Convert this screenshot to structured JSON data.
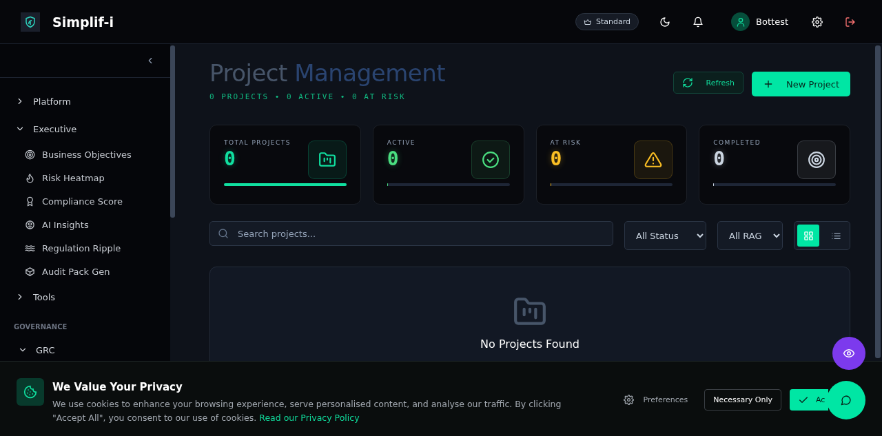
{
  "header": {
    "brand": "Simplif-i",
    "plan": "Standard",
    "user": "Bottest"
  },
  "sidebar": {
    "items": [
      {
        "label": "Platform",
        "expanded": false
      },
      {
        "label": "Executive",
        "expanded": true,
        "children": [
          {
            "label": "Business Objectives"
          },
          {
            "label": "Risk Heatmap"
          },
          {
            "label": "Compliance Score"
          },
          {
            "label": "AI Insights"
          },
          {
            "label": "Regulation Ripple"
          },
          {
            "label": "Audit Pack Gen"
          }
        ]
      },
      {
        "label": "Tools",
        "expanded": false
      }
    ],
    "section_label": "GOVERNANCE",
    "section_items": [
      {
        "label": "GRC",
        "expanded": true
      }
    ]
  },
  "page": {
    "title": "Project",
    "title_accent": "Management",
    "subtitle": "0 PROJECTS • 0 ACTIVE • 0 AT RISK",
    "buttons": [
      {
        "label": "Refresh",
        "kind": "secondary"
      },
      {
        "label": "New Project",
        "kind": "primary"
      }
    ]
  },
  "stats": [
    {
      "label": "TOTAL PROJECTS",
      "value": "0",
      "color": "#10e0a0",
      "level": 1
    },
    {
      "label": "ACTIVE",
      "value": "0",
      "color": "#4ade80",
      "level": 0
    },
    {
      "label": "AT RISK",
      "value": "0",
      "color": "#fbbf24",
      "level": 0
    },
    {
      "label": "COMPLETED",
      "value": "0",
      "color": "#cbd5e1",
      "level": 0
    }
  ],
  "filters": {
    "search": {
      "placeholder": "Search projects..."
    },
    "selects": [
      "All Status",
      "All RAG"
    ],
    "views": [
      {
        "kind": "grid",
        "selected": true
      },
      {
        "kind": "list",
        "selected": false
      }
    ]
  },
  "empty_state": {
    "title": "No Projects Found"
  },
  "cookie_banner": {
    "title": "We Value Your Privacy",
    "text": "We use cookies to enhance your browsing experience, serve personalised content, and analyse our traffic. By clicking \"Accept All\", you consent to our use of cookies.",
    "link": "Read our Privacy Policy",
    "buttons": [
      {
        "label": "Preferences",
        "kind": "ghost"
      },
      {
        "label": "Necessary Only",
        "kind": "outline"
      },
      {
        "label": "Ac",
        "kind": "primary"
      }
    ]
  }
}
